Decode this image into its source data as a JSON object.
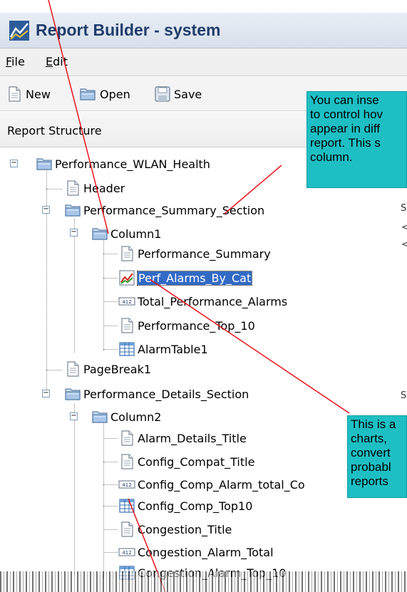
{
  "window": {
    "title": "Report Builder - system"
  },
  "menu": {
    "file": {
      "mnemonic": "F",
      "rest": "ile"
    },
    "edit": {
      "mnemonic": "E",
      "rest": "dit"
    }
  },
  "toolbar": {
    "new_label": "New",
    "open_label": "Open",
    "save_label": "Save"
  },
  "panel": {
    "title": "Report Structure"
  },
  "tree": {
    "root": "Performance_WLAN_Health",
    "header": "Header",
    "summary_section": "Performance_Summary_Section",
    "column1": "Column1",
    "performance_summary": "Performance_Summary",
    "perf_alarms_by_cat": "Perf_Alarms_By_Cat",
    "total_performance_alarms": "Total_Performance_Alarms",
    "performance_top_10": "Performance_Top_10",
    "alarm_table1": "AlarmTable1",
    "page_break1": "PageBreak1",
    "details_section": "Performance_Details_Section",
    "column2": "Column2",
    "alarm_details_title": "Alarm_Details_Title",
    "config_compat_title": "Config_Compat_Title",
    "config_comp_alarm_total": "Config_Comp_Alarm_total_Co",
    "config_comp_top10": "Config_Comp_Top10",
    "congestion_title": "Congestion_Title",
    "congestion_alarm_total": "Congestion_Alarm_Total",
    "congestion_alarm_top_10": "Congestion_Alarm_Top_10"
  },
  "callouts": {
    "top": [
      "You can inse",
      "to control hov",
      "appear in diff",
      "report. This s",
      "column."
    ],
    "bottom": [
      "This is a",
      "charts, ",
      "convert",
      "probabl",
      "reports"
    ]
  },
  "right_fragments": [
    "S",
    "<",
    "<",
    "S"
  ],
  "colors": {
    "callout": "#1dbfc4",
    "selection": "#316ac5",
    "annotation_line": "#e8141b",
    "title_text": "#1f3d6b"
  },
  "icons": {
    "app": "report-builder-icon",
    "new": "new-document-icon",
    "open": "open-folder-icon",
    "save": "save-disk-icon",
    "report": "report-folder-icon",
    "section": "section-folder-icon",
    "column": "column-folder-icon",
    "text": "text-element-icon",
    "chart": "line-chart-icon",
    "number": "number-element-icon",
    "table": "table-icon"
  }
}
